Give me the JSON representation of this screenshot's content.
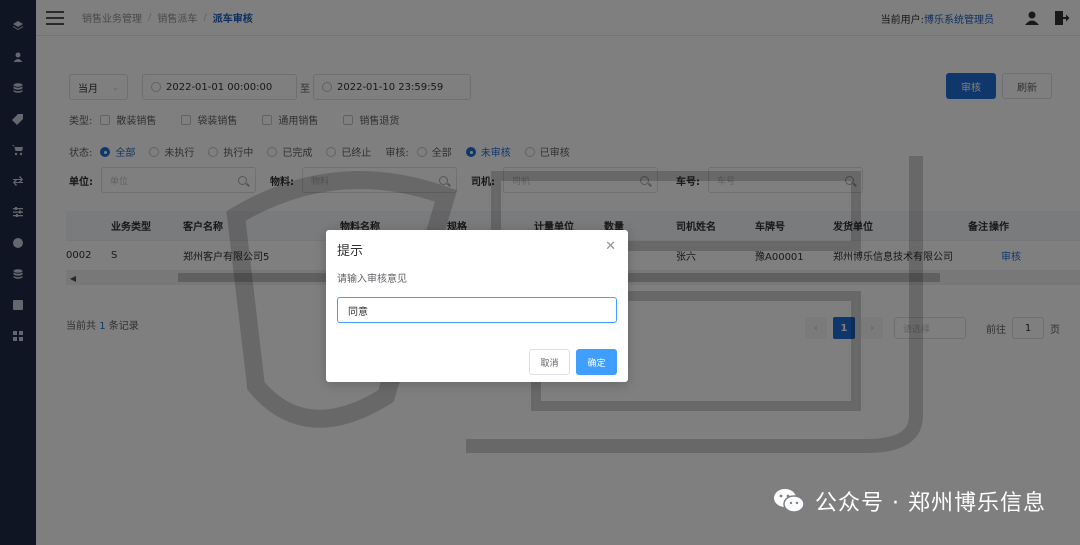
{
  "sidebar": {
    "icons": [
      "layers-icon",
      "user-icon",
      "database-icon",
      "tag-icon",
      "cart-icon",
      "transfer-icon",
      "sliders-icon",
      "shield-icon",
      "stack-icon",
      "report-icon",
      "grid-icon"
    ]
  },
  "header": {
    "breadcrumb": [
      "销售业务管理",
      "销售派车",
      "派车审核"
    ],
    "user_label": "当前用户:",
    "user_name": "博乐系统管理员"
  },
  "filters": {
    "period": "当月",
    "date_from": "2022-01-01 00:00:00",
    "date_sep": "至",
    "date_to": "2022-01-10 23:59:59",
    "type_label": "类型:",
    "types": [
      "散装销售",
      "袋装销售",
      "通用销售",
      "销售退货"
    ],
    "status_label": "状态:",
    "statuses": [
      "全部",
      "未执行",
      "执行中",
      "已完成",
      "已终止"
    ],
    "status_selected": "全部",
    "audit_label": "审核:",
    "audits": [
      "全部",
      "未审核",
      "已审核"
    ],
    "audit_selected": "未审核",
    "unit_label": "单位:",
    "unit_placeholder": "单位",
    "material_label": "物料:",
    "material_placeholder": "物料",
    "driver_label": "司机:",
    "driver_placeholder": "司机",
    "plate_label": "车号:",
    "plate_placeholder": "车号"
  },
  "actions": {
    "audit_button": "审核",
    "refresh_button": "刷新"
  },
  "table": {
    "columns": [
      "业务类型",
      "客户名称",
      "物料名称",
      "规格",
      "计量单位",
      "数量",
      "司机姓名",
      "车牌号",
      "发货单位",
      "备注",
      "操作"
    ],
    "rows": [
      {
        "id": "0002",
        "biz_type": "S",
        "customer": "郑州客户有限公司5",
        "driver": "张六",
        "plate": "豫A00001",
        "shipper": "郑州博乐信息技术有限公司",
        "action": "审核"
      }
    ]
  },
  "pager": {
    "total_prefix": "当前共",
    "total_count": "1",
    "total_suffix": "条记录",
    "current_page": "1",
    "page_size_placeholder": "请选择",
    "goto_label": "前往",
    "goto_value": "1",
    "page_unit": "页"
  },
  "dialog": {
    "title": "提示",
    "message": "请输入审核意见",
    "input_value": "同意",
    "cancel_label": "取消",
    "ok_label": "确定"
  },
  "footer_watermark": {
    "text": "公众号 · 郑州博乐信息"
  },
  "colors": {
    "sidebar": "#1e2a44",
    "primary": "#1e6fd9",
    "dialog_primary": "#409eff"
  }
}
